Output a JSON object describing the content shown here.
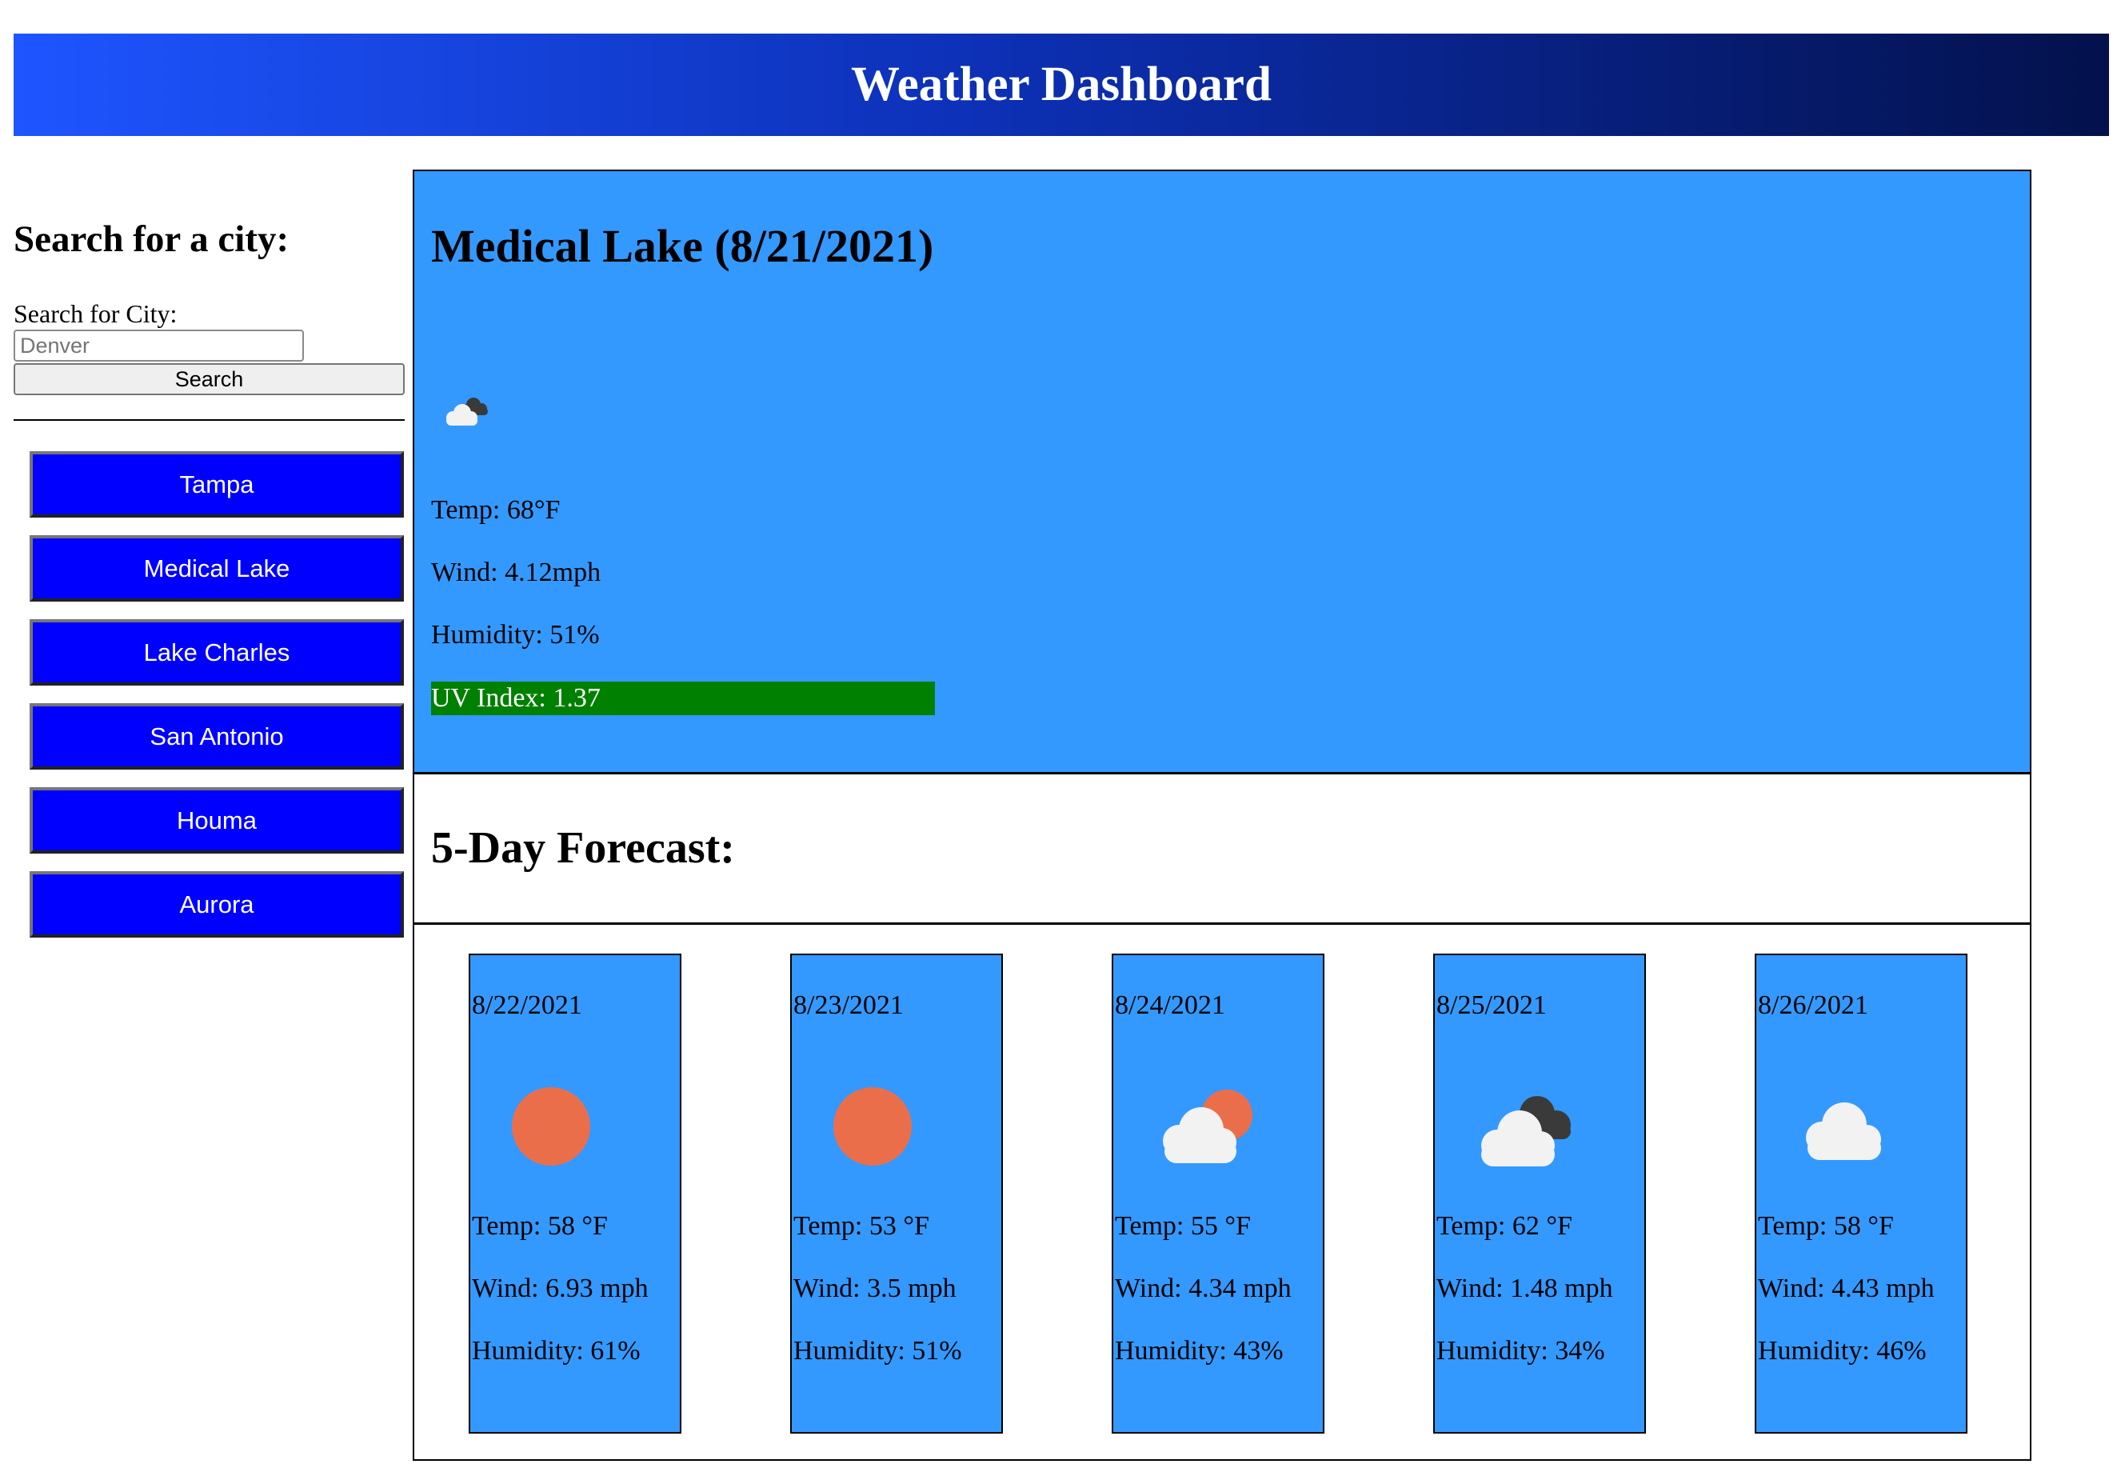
{
  "header": {
    "title": "Weather Dashboard"
  },
  "sidebar": {
    "heading": "Search for a city:",
    "search_label": "Search for City:",
    "search_placeholder": "Denver",
    "search_value": "",
    "search_button": "Search",
    "history": [
      "Tampa",
      "Medical Lake",
      "Lake Charles",
      "San Antonio",
      "Houma",
      "Aurora"
    ]
  },
  "current": {
    "title": "Medical Lake (8/21/2021)",
    "icon": "cloud-dark-cloud-icon",
    "temp": "Temp: 68°F",
    "wind": "Wind: 4.12mph",
    "humidity": "Humidity: 51%",
    "uv": "UV Index: 1.37",
    "uv_color": "#008000"
  },
  "forecast": {
    "heading": "5-Day Forecast:",
    "days": [
      {
        "date": "8/22/2021",
        "icon": "sun-icon",
        "temp": "Temp: 58 °F",
        "wind": "Wind: 6.93 mph",
        "humidity": "Humidity: 61%"
      },
      {
        "date": "8/23/2021",
        "icon": "sun-icon",
        "temp": "Temp: 53 °F",
        "wind": "Wind: 3.5 mph",
        "humidity": "Humidity: 51%"
      },
      {
        "date": "8/24/2021",
        "icon": "sun-behind-cloud-icon",
        "temp": "Temp: 55 °F",
        "wind": "Wind: 4.34 mph",
        "humidity": "Humidity: 43%"
      },
      {
        "date": "8/25/2021",
        "icon": "cloud-dark-cloud-icon",
        "temp": "Temp: 62 °F",
        "wind": "Wind: 1.48 mph",
        "humidity": "Humidity: 34%"
      },
      {
        "date": "8/26/2021",
        "icon": "cloud-icon",
        "temp": "Temp: 58 °F",
        "wind": "Wind: 4.43 mph",
        "humidity": "Humidity: 46%"
      }
    ]
  },
  "colors": {
    "panel": "#3399ff",
    "history_button": "#0000ff",
    "sun": "#eb6e4b",
    "cloud": "#f2f2f2",
    "dark_cloud": "#3a3a3a"
  }
}
